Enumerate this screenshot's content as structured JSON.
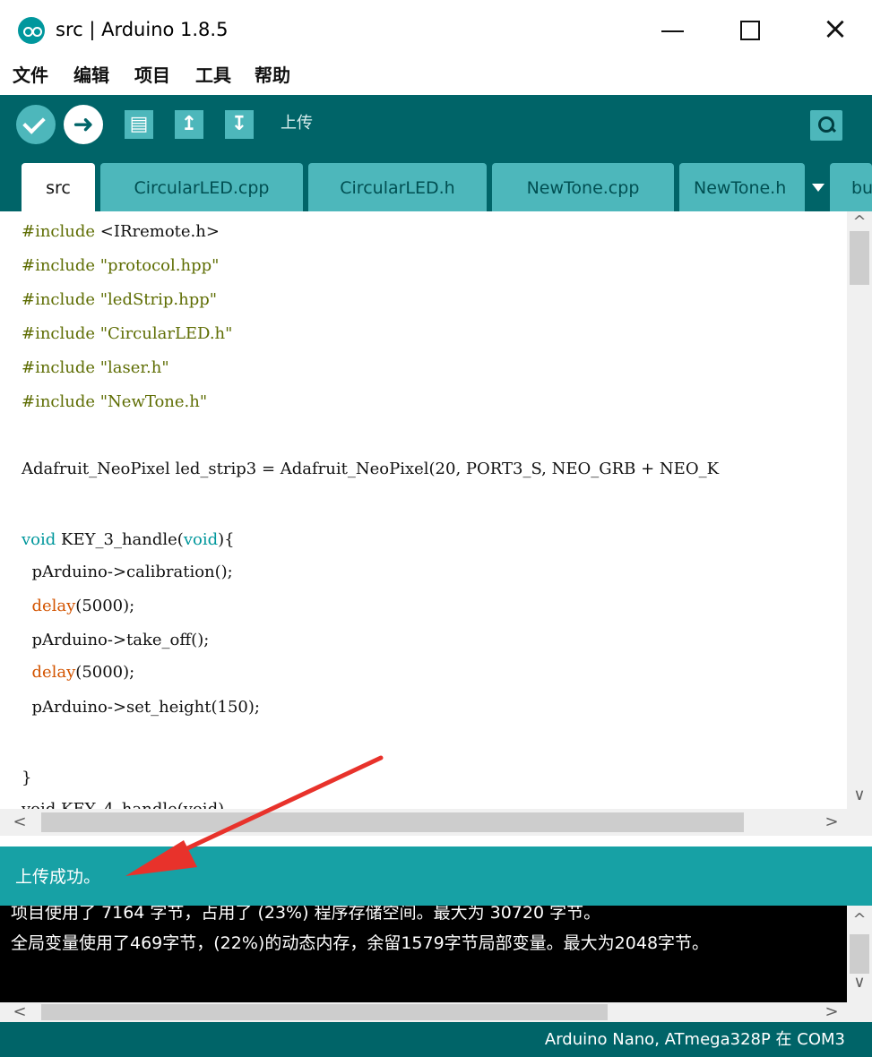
{
  "window": {
    "title": "src | Arduino 1.8.5",
    "close_glyph": "×"
  },
  "menu": {
    "items": [
      "文件",
      "编辑",
      "项目",
      "工具",
      "帮助"
    ]
  },
  "toolbar": {
    "upload_glyph": "➜",
    "new_glyph": "▤",
    "open_glyph": "↥",
    "save_glyph": "↧",
    "label": "上传"
  },
  "tabs": [
    "src",
    "CircularLED.cpp",
    "CircularLED.h",
    "NewTone.cpp",
    "NewTone.h",
    "bu"
  ],
  "code": {
    "line_1": {
      "kw": "#include",
      "rest": " <IRremote.h>"
    },
    "line_2": {
      "kw": "#include",
      "rest": " \"protocol.hpp\""
    },
    "line_3": {
      "kw": "#include",
      "rest": " \"ledStrip.hpp\""
    },
    "line_4": {
      "kw": "#include",
      "rest": " \"CircularLED.h\""
    },
    "line_5": {
      "kw": "#include",
      "rest": " \"laser.h\""
    },
    "line_6": {
      "kw": "#include",
      "rest": " \"NewTone.h\""
    },
    "line_8": "Adafruit_NeoPixel led_strip3 = Adafruit_NeoPixel(20, PORT3_S, NEO_GRB + NEO_K",
    "line_10": {
      "t1": "void",
      "t2": " KEY_3_handle(",
      "t3": "void",
      "t4": "){"
    },
    "line_11": "  pArduino->calibration();",
    "line_12": {
      "fn": "delay",
      "rest": "(5000);"
    },
    "line_13": "  pArduino->take_off();",
    "line_14": {
      "fn": "delay",
      "rest": "(5000);"
    },
    "line_15": "  pArduino->set_height(150);",
    "line_17": "}",
    "line_18": "void KEY_4_handle(void)"
  },
  "scroll": {
    "up": "^",
    "down": "∨",
    "left": "<",
    "right": ">"
  },
  "status": {
    "message": "上传成功。"
  },
  "console": {
    "line_1": "项目使用了 7164 字节，占用了 (23%) 程序存储空间。最大为 30720 字节。",
    "line_2": "全局变量使用了469字节，(22%)的动态内存，余留1579字节局部变量。最大为2048字节。"
  },
  "footer": {
    "board_info": "Arduino Nano, ATmega328P 在 COM3"
  },
  "colors": {
    "toolbar": "#006468",
    "accent": "#4db7bb",
    "status": "#17a1a5",
    "annotation": "#e8322b"
  }
}
